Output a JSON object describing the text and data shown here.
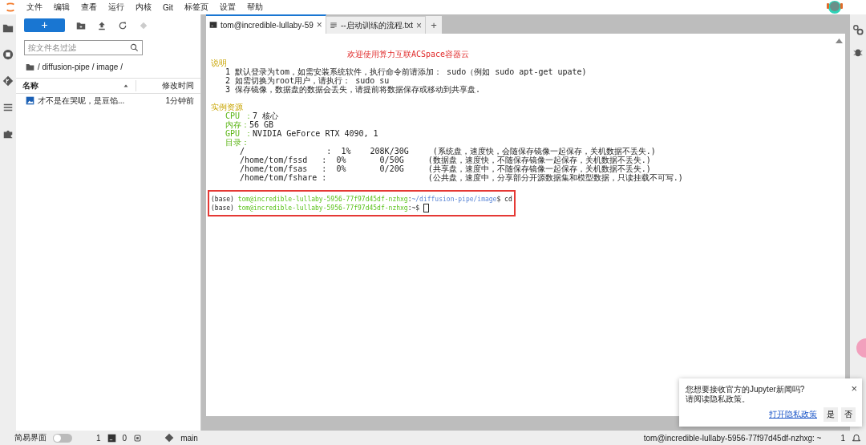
{
  "menu": [
    "文件",
    "编辑",
    "查看",
    "运行",
    "内核",
    "Git",
    "标签页",
    "设置",
    "帮助"
  ],
  "file_browser": {
    "new_button": "+",
    "filter_placeholder": "按文件名过滤",
    "breadcrumb": "/ diffusion-pipe / image /",
    "columns": [
      "名称",
      "修改时间"
    ],
    "files": [
      {
        "name": "才不是在哭呢，是豆馅...",
        "modified": "1分钟前",
        "selected": false
      }
    ]
  },
  "tabs": [
    {
      "kind": "terminal",
      "label": "tom@incredible-lullaby-59",
      "close": "×",
      "selected": true
    },
    {
      "kind": "text",
      "label": "--启动训练的流程.txt",
      "close": "×",
      "selected": false
    }
  ],
  "new_tab": "+",
  "terminal": {
    "lines": [
      {
        "kind": "title",
        "segments": [
          {
            "kind": "title",
            "text": "欢迎使用算力互联ACSpace容器云"
          }
        ]
      },
      {
        "kind": "heading",
        "segments": [
          {
            "kind": "heading",
            "text": "说明"
          }
        ]
      },
      {
        "kind": "item",
        "segments": [
          {
            "kind": "plain",
            "text": "1 默认登录为tom，如需安装系统软件，执行命令前请添加： sudo（例如 sudo apt-get upate)"
          }
        ]
      },
      {
        "kind": "item",
        "segments": [
          {
            "kind": "plain",
            "text": "2 如需切换为root用户，请执行： sudo su"
          }
        ]
      },
      {
        "kind": "item",
        "segments": [
          {
            "kind": "plain",
            "text": "3 保存镜像，数据盘的数据会丢失，请提前将数据保存或移动到共享盘."
          }
        ]
      },
      {
        "kind": "blank"
      },
      {
        "kind": "heading",
        "segments": [
          {
            "kind": "heading",
            "text": "实例资源"
          }
        ]
      },
      {
        "kind": "item",
        "segments": [
          {
            "kind": "label",
            "text": "CPU ："
          },
          {
            "kind": "plain",
            "text": "7 核心"
          }
        ]
      },
      {
        "kind": "item",
        "segments": [
          {
            "kind": "label",
            "text": "内存："
          },
          {
            "kind": "plain",
            "text": "56 GB"
          }
        ]
      },
      {
        "kind": "item",
        "segments": [
          {
            "kind": "label",
            "text": "GPU ："
          },
          {
            "kind": "plain",
            "text": "NVIDIA GeForce RTX 4090, 1"
          }
        ]
      },
      {
        "kind": "item",
        "segments": [
          {
            "kind": "label",
            "text": "目录："
          }
        ]
      },
      {
        "kind": "disk",
        "segments": [
          {
            "kind": "plain",
            "text": "/                 :  1%    208K/30G     (系统盘，速度快，会随保存镜像一起保存，关机数据不丢失.)"
          }
        ]
      },
      {
        "kind": "disk",
        "segments": [
          {
            "kind": "plain",
            "text": "/home/tom/fssd   :  0%       0/50G     (数据盘，速度快，不随保存镜像一起保存，关机数据不丢失.)"
          }
        ]
      },
      {
        "kind": "disk",
        "segments": [
          {
            "kind": "plain",
            "text": "/home/tom/fsas   :  0%       0/20G     (共享盘，速度中，不随保存镜像一起保存，关机数据不丢失.)"
          }
        ]
      },
      {
        "kind": "disk",
        "segments": [
          {
            "kind": "plain",
            "text": "/home/tom/fshare :                     (公共盘，速度中，分享部分开源数据集和模型数据，只读挂载不可写.)"
          }
        ]
      }
    ],
    "prompts": [
      {
        "segments": [
          {
            "kind": "plain",
            "text": "(base) "
          },
          {
            "kind": "user",
            "text": "tom@incredible-lullaby-5956-77f97d45df-nzhxg"
          },
          {
            "kind": "plain",
            "text": ":"
          },
          {
            "kind": "path",
            "text": "~/diffusion-pipe/image"
          },
          {
            "kind": "plain",
            "text": "$ cd"
          }
        ],
        "cursor": false
      },
      {
        "segments": [
          {
            "kind": "plain",
            "text": "(base) "
          },
          {
            "kind": "user",
            "text": "tom@incredible-lullaby-5956-77f97d45df-nzhxg"
          },
          {
            "kind": "plain",
            "text": ":"
          },
          {
            "kind": "plain",
            "text": "~$ "
          }
        ],
        "cursor": true
      }
    ]
  },
  "notification": {
    "message": "您想要接收官方的Jupyter新闻吗?",
    "sub": "请阅读隐私政策。",
    "close": "×",
    "link": "打开隐私政策",
    "buttons": [
      "是",
      "否"
    ]
  },
  "status_bar": {
    "simple_mode": {
      "label": "简易界面",
      "on": false
    },
    "terminals": "1",
    "kernels": "0",
    "branch": "main",
    "host": "tom@incredible-lullaby-5956-77f97d45df-nzhxg: ~",
    "notifications": "1"
  }
}
